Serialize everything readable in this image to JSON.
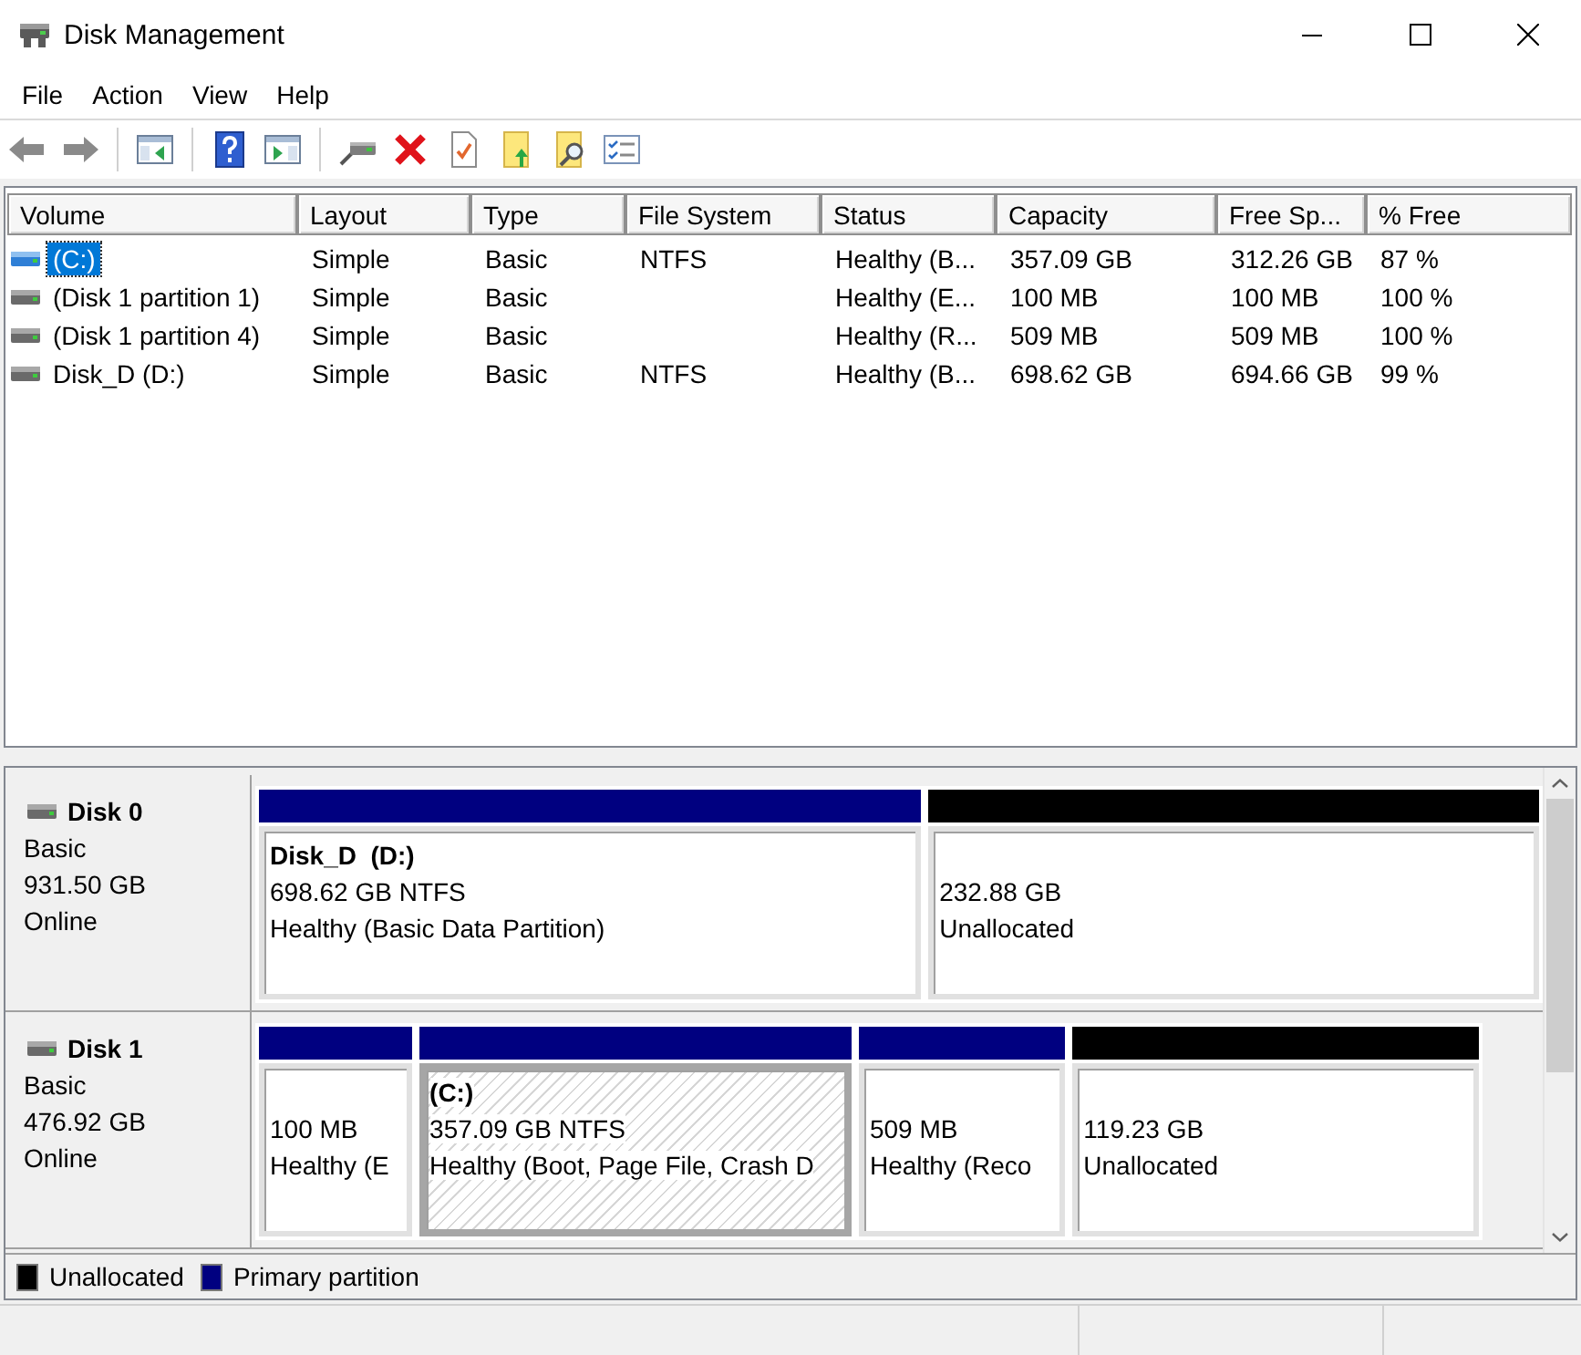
{
  "window": {
    "title": "Disk Management"
  },
  "menu": [
    "File",
    "Action",
    "View",
    "Help"
  ],
  "toolbar": [
    [
      {
        "kind": "back",
        "disabled": true
      },
      {
        "kind": "forward",
        "disabled": true
      }
    ],
    [
      {
        "kind": "console_tree",
        "disabled": false
      }
    ],
    [
      {
        "kind": "help",
        "disabled": false
      },
      {
        "kind": "action_pane",
        "disabled": false
      }
    ],
    [
      {
        "kind": "connect",
        "disabled": false
      },
      {
        "kind": "delete",
        "disabled": false
      },
      {
        "kind": "properties",
        "disabled": false
      },
      {
        "kind": "folder_up",
        "disabled": false
      },
      {
        "kind": "folder_search",
        "disabled": false
      },
      {
        "kind": "list",
        "disabled": false
      }
    ]
  ],
  "table": {
    "columns": [
      "Volume",
      "Layout",
      "Type",
      "File System",
      "Status",
      "Capacity",
      "Free Sp...",
      "% Free"
    ],
    "rows": [
      {
        "selected": true,
        "volume": "(C:)",
        "layout": "Simple",
        "type": "Basic",
        "file_system": "NTFS",
        "status": "Healthy (B...",
        "capacity": "357.09 GB",
        "free_sp": "312.26 GB",
        "percent_free": "87 %"
      },
      {
        "selected": false,
        "volume": "(Disk 1 partition 1)",
        "layout": "Simple",
        "type": "Basic",
        "status": "Healthy (E...",
        "capacity": "100 MB",
        "free_sp": "100 MB",
        "percent_free": "100 %"
      },
      {
        "selected": false,
        "volume": "(Disk 1 partition 4)",
        "layout": "Simple",
        "type": "Basic",
        "status": "Healthy (R...",
        "capacity": "509 MB",
        "free_sp": "509 MB",
        "percent_free": "100 %"
      },
      {
        "selected": false,
        "volume": "Disk_D (D:)",
        "layout": "Simple",
        "type": "Basic",
        "file_system": "NTFS",
        "status": "Healthy (B...",
        "capacity": "698.62 GB",
        "free_sp": "694.66 GB",
        "percent_free": "99 %"
      }
    ]
  },
  "disks": [
    {
      "name": "Disk 0",
      "type": "Basic",
      "size": "931.50 GB",
      "status": "Online",
      "partitions": [
        {
          "kind": "primary",
          "selected": false,
          "title": "Disk_D  (D:)",
          "size": "698.62 GB NTFS",
          "status": "Healthy (Basic Data Partition)"
        },
        {
          "kind": "unallocated",
          "selected": false,
          "size": "232.88 GB",
          "status": "Unallocated"
        }
      ]
    },
    {
      "name": "Disk 1",
      "type": "Basic",
      "size": "476.92 GB",
      "status": "Online",
      "partitions": [
        {
          "kind": "primary",
          "selected": false,
          "size": "100 MB",
          "status": "Healthy (E"
        },
        {
          "kind": "primary",
          "selected": true,
          "title": "(C:)",
          "size": "357.09 GB NTFS",
          "status": "Healthy (Boot, Page File, Crash D"
        },
        {
          "kind": "primary",
          "selected": false,
          "size": "509 MB",
          "status": "Healthy (Reco"
        },
        {
          "kind": "unallocated",
          "selected": false,
          "size": "119.23 GB",
          "status": "Unallocated"
        }
      ]
    }
  ],
  "legend": [
    {
      "kind": "unallocated",
      "label": "Unallocated",
      "color": "#000000"
    },
    {
      "kind": "primary",
      "label": "Primary partition",
      "color": "#000080"
    }
  ]
}
